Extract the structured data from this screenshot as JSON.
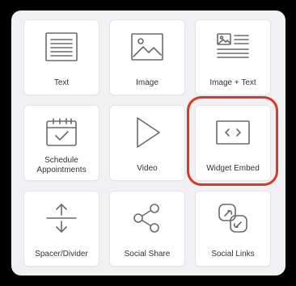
{
  "blocks": [
    {
      "label": "Text",
      "icon": "text-icon"
    },
    {
      "label": "Image",
      "icon": "image-icon"
    },
    {
      "label": "Image + Text",
      "icon": "image-text-icon"
    },
    {
      "label": "Schedule Appointments",
      "icon": "calendar-icon"
    },
    {
      "label": "Video",
      "icon": "play-icon"
    },
    {
      "label": "Widget Embed",
      "icon": "code-embed-icon",
      "highlighted": true
    },
    {
      "label": "Spacer/Divider",
      "icon": "spacer-divider-icon"
    },
    {
      "label": "Social Share",
      "icon": "share-icon"
    },
    {
      "label": "Social Links",
      "icon": "link-icon"
    }
  ],
  "colors": {
    "highlight": "#d63a2a",
    "icon": "#6b6b6b",
    "panel": "#f1f1f3",
    "tile": "#ffffff"
  }
}
